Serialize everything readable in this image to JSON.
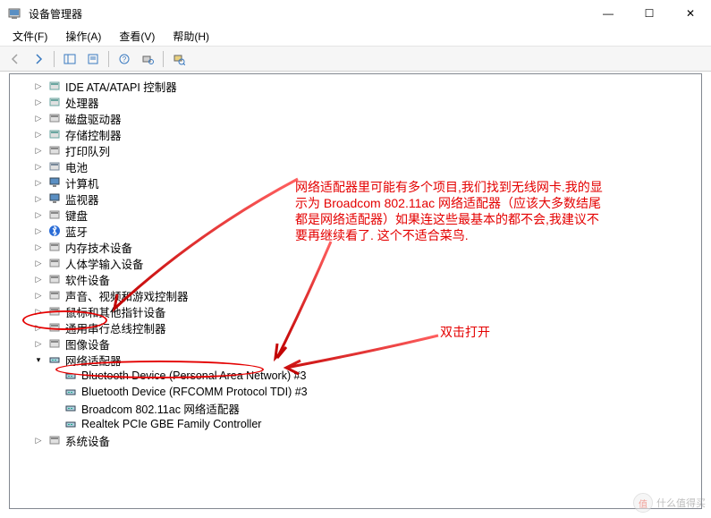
{
  "window": {
    "title": "设备管理器",
    "min": "—",
    "max": "☐",
    "close": "✕"
  },
  "menu": {
    "file": "文件(F)",
    "action": "操作(A)",
    "view": "查看(V)",
    "help": "帮助(H)"
  },
  "annotations": {
    "main_text": "网络适配器里可能有多个项目,我们找到无线网卡.我的显示为 Broadcom 802.11ac 网络适配器（应该大多数结尾都是网络适配器）如果连这些最基本的都不会,我建议不要再继续看了. 这个不适合菜鸟.",
    "dbl_click": "双击打开"
  },
  "tree": [
    {
      "label": "IDE ATA/ATAPI 控制器",
      "icon": "ide"
    },
    {
      "label": "处理器",
      "icon": "cpu"
    },
    {
      "label": "磁盘驱动器",
      "icon": "disk"
    },
    {
      "label": "存储控制器",
      "icon": "storage"
    },
    {
      "label": "打印队列",
      "icon": "printer"
    },
    {
      "label": "电池",
      "icon": "battery"
    },
    {
      "label": "计算机",
      "icon": "computer"
    },
    {
      "label": "监视器",
      "icon": "monitor"
    },
    {
      "label": "键盘",
      "icon": "keyboard"
    },
    {
      "label": "蓝牙",
      "icon": "bluetooth"
    },
    {
      "label": "内存技术设备",
      "icon": "memory"
    },
    {
      "label": "人体学输入设备",
      "icon": "hid"
    },
    {
      "label": "软件设备",
      "icon": "software"
    },
    {
      "label": "声音、视频和游戏控制器",
      "icon": "sound"
    },
    {
      "label": "鼠标和其他指针设备",
      "icon": "mouse"
    },
    {
      "label": "通用串行总线控制器",
      "icon": "usb"
    },
    {
      "label": "图像设备",
      "icon": "imaging"
    }
  ],
  "network": {
    "label": "网络适配器",
    "children": [
      "Bluetooth Device (Personal Area Network) #3",
      "Bluetooth Device (RFCOMM Protocol TDI) #3",
      "Broadcom 802.11ac 网络适配器",
      "Realtek PCIe GBE Family Controller"
    ]
  },
  "system_devices": "系统设备",
  "watermark": {
    "char": "值",
    "text": "什么值得买"
  }
}
